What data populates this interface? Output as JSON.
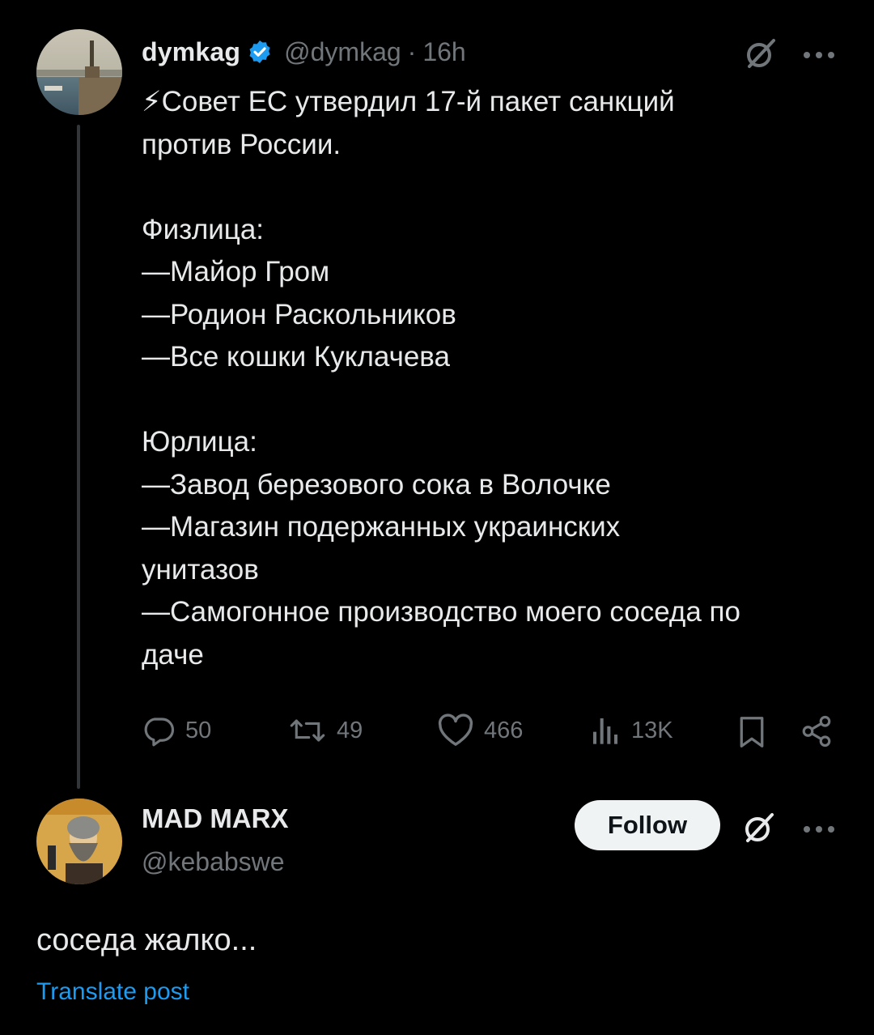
{
  "post": {
    "author_name": "dymkag",
    "author_handle": "@dymkag",
    "separator": "·",
    "time": "16h",
    "text": "⚡Совет ЕС утвердил 17-й пакет санкций\nпротив России.\n\nФизлица:\n—Майор Гром\n—Родион Раскольников\n—Все кошки Куклачева\n\nЮрлица:\n—Завод березового сока в Волочке\n—Магазин подержанных украинских\nунитазов\n—Самогонное производство моего соседа по\nдаче",
    "stats": {
      "replies": "50",
      "reposts": "49",
      "likes": "466",
      "views": "13K"
    }
  },
  "reply": {
    "author_name": "MAD MARX",
    "author_handle": "@kebabswe",
    "follow_label": "Follow",
    "text": "соседа жалко...",
    "translate_label": "Translate post"
  },
  "colors": {
    "background": "#000000",
    "text": "#e7e9ea",
    "secondary": "#71767b",
    "accent": "#1d9bf0"
  }
}
